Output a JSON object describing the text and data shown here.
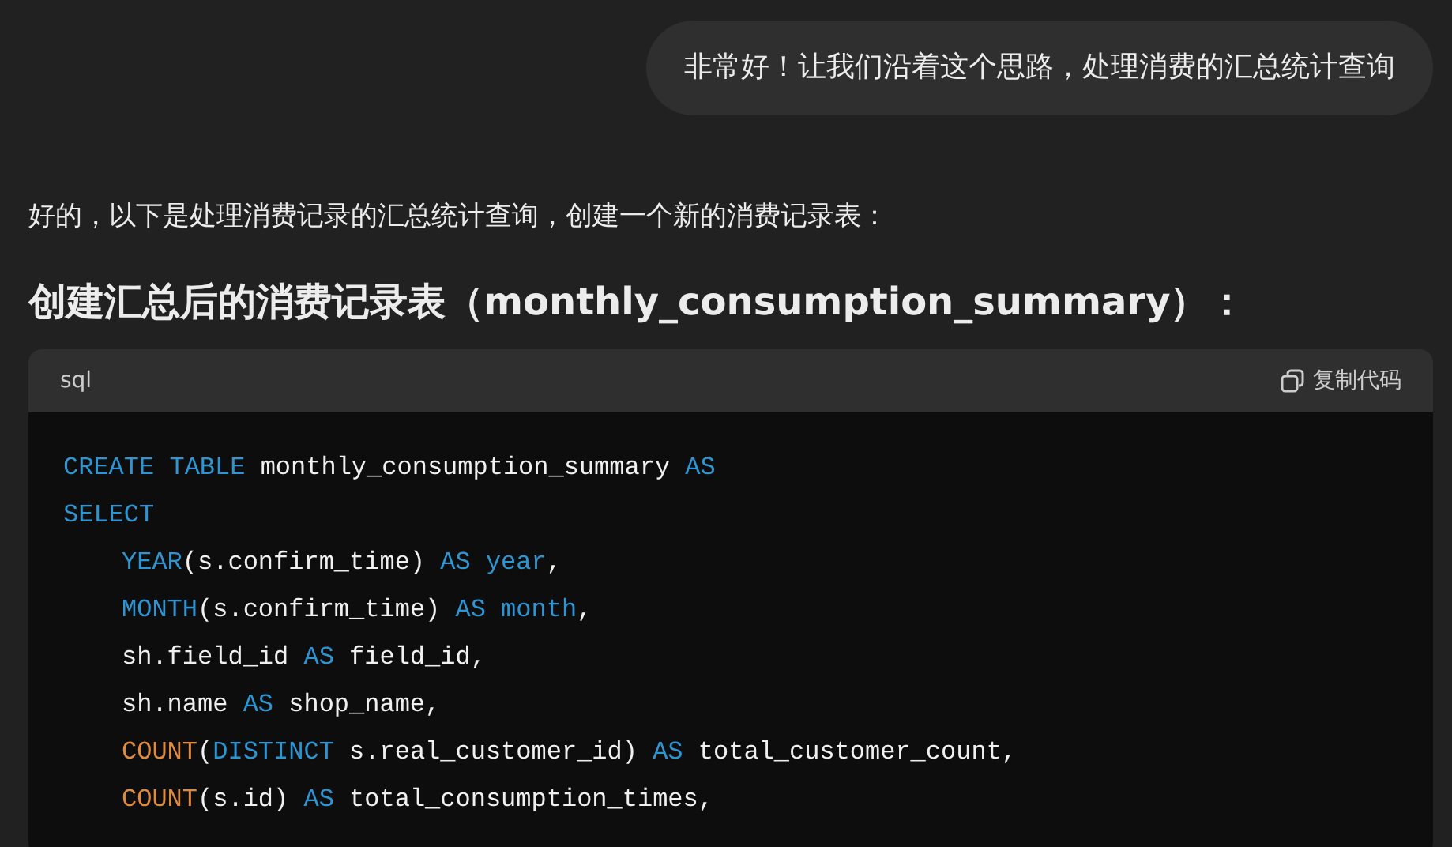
{
  "user_message": "非常好！让我们沿着这个思路，处理消费的汇总统计查询",
  "reply": {
    "intro": "好的，以下是处理消费记录的汇总统计查询，创建一个新的消费记录表：",
    "heading": "创建汇总后的消费记录表（monthly_consumption_summary）：",
    "code_block": {
      "language": "sql",
      "copy_label": "复制代码",
      "lines": [
        {
          "tokens": [
            {
              "kind": "keyword",
              "text": "CREATE TABLE"
            },
            {
              "kind": "plain",
              "text": " monthly_consumption_summary "
            },
            {
              "kind": "keyword",
              "text": "AS"
            }
          ]
        },
        {
          "tokens": [
            {
              "kind": "keyword",
              "text": "SELECT"
            }
          ],
          "children": [
            {
              "tokens": [
                {
                  "kind": "keyword",
                  "text": "YEAR"
                },
                {
                  "kind": "plain",
                  "text": "(s.confirm_time) "
                },
                {
                  "kind": "keyword",
                  "text": "AS"
                },
                {
                  "kind": "keyword",
                  "text": " year"
                },
                {
                  "kind": "plain",
                  "text": ","
                }
              ]
            },
            {
              "tokens": [
                {
                  "kind": "keyword",
                  "text": "MONTH"
                },
                {
                  "kind": "plain",
                  "text": "(s.confirm_time) "
                },
                {
                  "kind": "keyword",
                  "text": "AS"
                },
                {
                  "kind": "keyword",
                  "text": " month"
                },
                {
                  "kind": "plain",
                  "text": ","
                }
              ]
            },
            {
              "tokens": [
                {
                  "kind": "plain",
                  "text": "sh.field_id "
                },
                {
                  "kind": "keyword",
                  "text": "AS"
                },
                {
                  "kind": "plain",
                  "text": " field_id,"
                }
              ]
            },
            {
              "tokens": [
                {
                  "kind": "plain",
                  "text": "sh.name "
                },
                {
                  "kind": "keyword",
                  "text": "AS"
                },
                {
                  "kind": "plain",
                  "text": " shop_name,"
                }
              ]
            },
            {
              "tokens": [
                {
                  "kind": "function",
                  "text": "COUNT"
                },
                {
                  "kind": "plain",
                  "text": "("
                },
                {
                  "kind": "keyword",
                  "text": "DISTINCT"
                },
                {
                  "kind": "plain",
                  "text": " s.real_customer_id) "
                },
                {
                  "kind": "keyword",
                  "text": "AS"
                },
                {
                  "kind": "plain",
                  "text": " total_customer_count,"
                }
              ]
            },
            {
              "tokens": [
                {
                  "kind": "function",
                  "text": "COUNT"
                },
                {
                  "kind": "plain",
                  "text": "(s.id) "
                },
                {
                  "kind": "keyword",
                  "text": "AS"
                },
                {
                  "kind": "plain",
                  "text": " total_consumption_times,"
                }
              ]
            }
          ]
        }
      ]
    }
  }
}
